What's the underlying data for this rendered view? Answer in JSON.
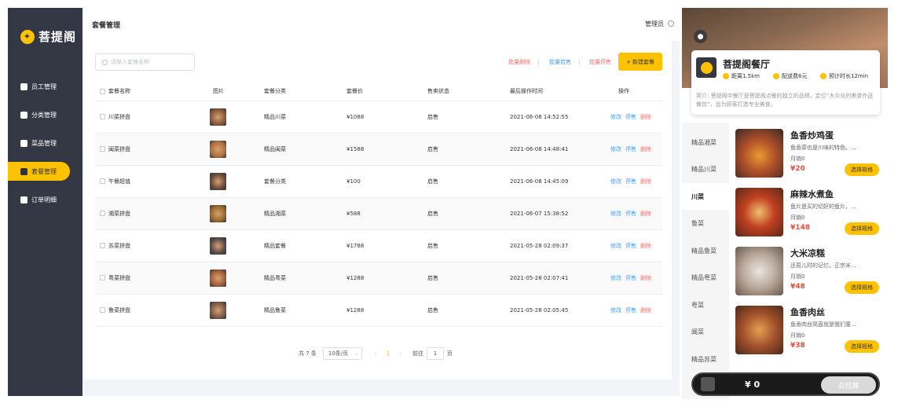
{
  "admin": {
    "logo": "菩提阁",
    "nav": [
      {
        "label": "员工管理",
        "icon": "user-info-icon"
      },
      {
        "label": "分类管理",
        "icon": "grid-icon"
      },
      {
        "label": "菜品管理",
        "icon": "dish-icon"
      },
      {
        "label": "套餐管理",
        "icon": "gift-icon",
        "active": true
      },
      {
        "label": "订单明细",
        "icon": "document-icon"
      }
    ],
    "page_title": "套餐管理",
    "admin_label": "管理员",
    "search_placeholder": "请输入套餐名称",
    "batch_delete": "批量删除",
    "batch_enable": "批量启售",
    "batch_disable": "批量停售",
    "new_button": "+ 新建套餐",
    "columns": [
      "套餐名称",
      "图片",
      "套餐分类",
      "套餐价",
      "售卖状态",
      "最后操作时间",
      "操作"
    ],
    "rows": [
      {
        "name": "川菜拼盘",
        "category": "精品川菜",
        "price": "¥1088",
        "status": "启售",
        "time": "2021-06-08 14:52:55"
      },
      {
        "name": "闽菜拼盘",
        "category": "精品闽菜",
        "price": "¥1588",
        "status": "启售",
        "time": "2021-06-08 14:48:41"
      },
      {
        "name": "午餐超值",
        "category": "套餐分类",
        "price": "¥100",
        "status": "启售",
        "time": "2021-06-08 14:45:09"
      },
      {
        "name": "湘菜拼盘",
        "category": "精品湘菜",
        "price": "¥588",
        "status": "启售",
        "time": "2021-06-07 15:38:52"
      },
      {
        "name": "苏菜拼盘",
        "category": "精品套餐",
        "price": "¥1788",
        "status": "启售",
        "time": "2021-05-28 02:09:37"
      },
      {
        "name": "粤菜拼盘",
        "category": "精品粤菜",
        "price": "¥1288",
        "status": "启售",
        "time": "2021-05-28 02:07:41"
      },
      {
        "name": "鲁菜拼盘",
        "category": "精品鲁菜",
        "price": "¥1288",
        "status": "启售",
        "time": "2021-05-28 02:05:45"
      }
    ],
    "op_edit": "修改",
    "op_stop": "停售",
    "op_delete": "删除",
    "pager": {
      "total": "共 7 条",
      "page_size": "10条/页",
      "current_page": "1",
      "goto_label": "前往",
      "goto_value": "1",
      "page_suffix": "页"
    }
  },
  "mobile": {
    "shop_name": "菩提阁餐厅",
    "distance": "距离1.5km",
    "delivery_fee": "配送费6元",
    "eta": "预计时长12min",
    "description": "简介: 菩提阁中餐厅是菩提阁点餐的独立的品牌，定位“大众化的美食外送餐饮”，旨为顾客打造专业美食。",
    "categories": [
      "精品湘菜",
      "精品川菜",
      "川菜",
      "鲁菜",
      "精品鲁菜",
      "精品粤菜",
      "粤菜",
      "闽菜",
      "精品苏菜"
    ],
    "active_category": "川菜",
    "dishes": [
      {
        "name": "鱼香炒鸡蛋",
        "desc": "鱼香菜也是川味的特色。...",
        "sales": "月销0",
        "price": "¥20",
        "button": "选择规格"
      },
      {
        "name": "麻辣水煮鱼",
        "desc": "鱼片是买的切好的鱼片，...",
        "sales": "月销0",
        "price": "¥148",
        "button": "选择规格"
      },
      {
        "name": "大米凉糕",
        "desc": "还原儿时的记忆，正宗米...",
        "sales": "月销0",
        "price": "¥48",
        "button": "选择规格"
      },
      {
        "name": "鱼香肉丝",
        "desc": "鱼香肉丝简直就是我们童...",
        "sales": "月销0",
        "price": "¥38",
        "button": "选择规格"
      }
    ],
    "cart_total": "¥ 0",
    "checkout": "去结算"
  },
  "colors": {
    "accent": "#ffc200",
    "sidebar": "#343744",
    "link": "#419eff",
    "danger": "#f56c6c",
    "price": "#e94e3c"
  }
}
